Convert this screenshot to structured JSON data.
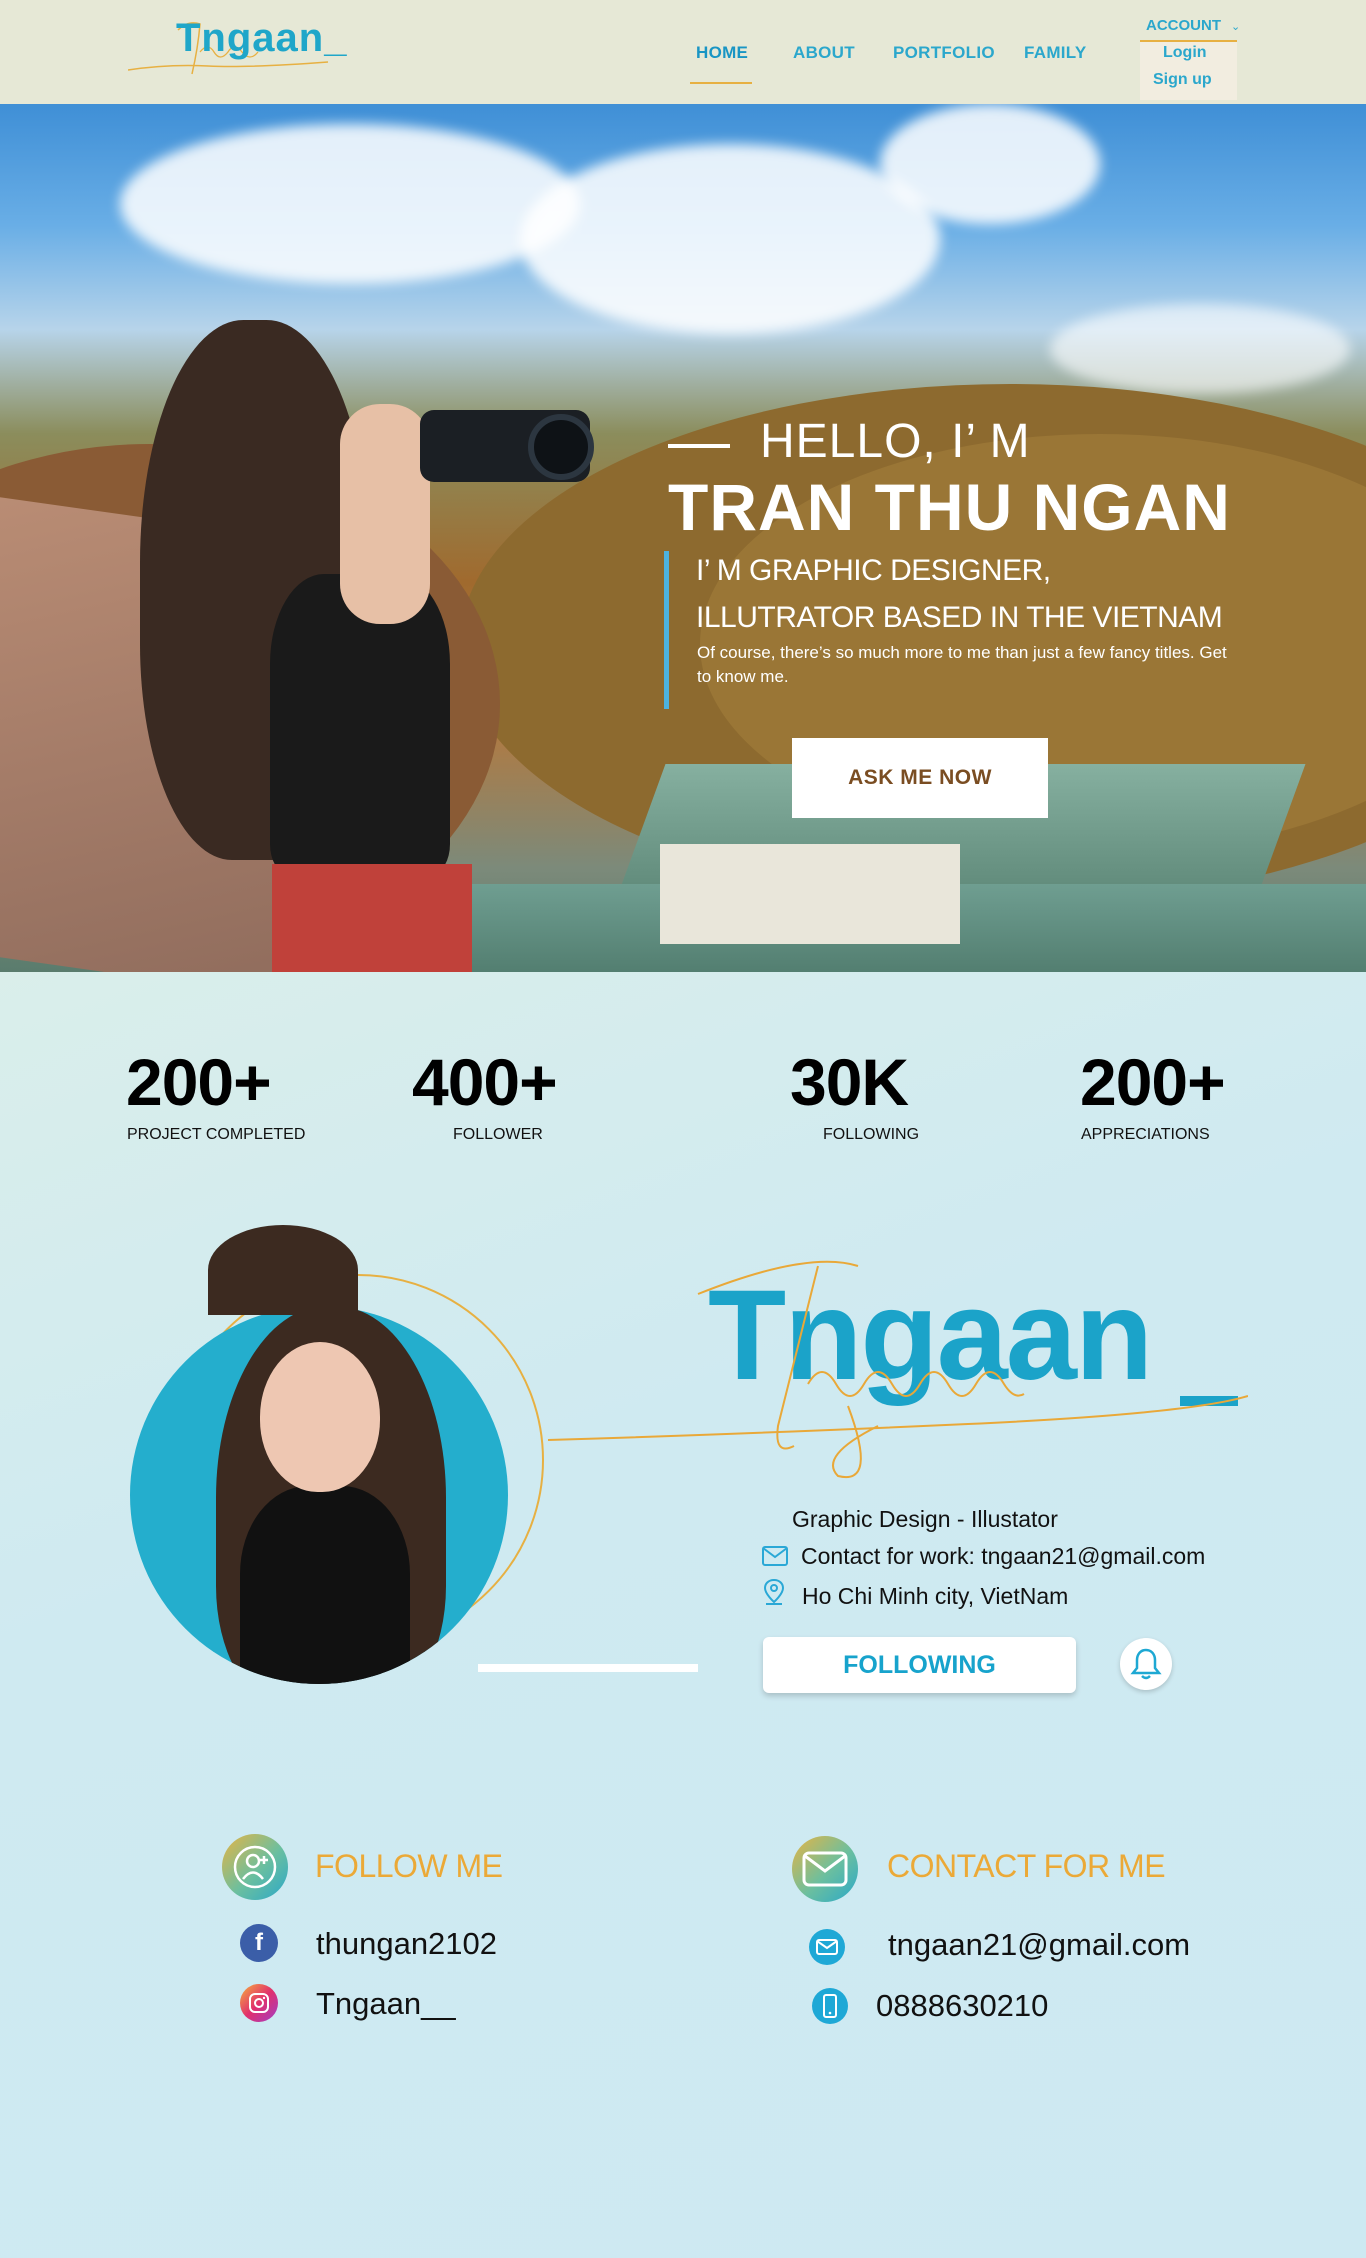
{
  "nav": {
    "logo_text": "Tngaan_",
    "items": [
      {
        "label": "HOME",
        "active": true
      },
      {
        "label": "ABOUT"
      },
      {
        "label": "PORTFOLIO"
      },
      {
        "label": "FAMILY"
      }
    ],
    "account": {
      "label": "ACCOUNT",
      "items": [
        "Login",
        "Sign up"
      ]
    }
  },
  "hero": {
    "greeting": "HELLO, I’ M",
    "name": "TRAN THU NGAN",
    "role_line1": "I’ M GRAPHIC DESIGNER,",
    "role_line2": "ILLUTRATOR BASED IN THE VIETNAM",
    "subtitle": "Of course, there’s so much more to me than just a few fancy titles. Get to know me.",
    "cta": "ASK ME NOW"
  },
  "stats": [
    {
      "value": "200+",
      "label": "PROJECT COMPLETED"
    },
    {
      "value": "400+",
      "label": "FOLLOWER"
    },
    {
      "value": "30K",
      "label": "FOLLOWING"
    },
    {
      "value": "200+",
      "label": "APPRECIATIONS"
    }
  ],
  "profile": {
    "brand": "Tngaan",
    "role": "Graphic Design - Illustator",
    "contact": "Contact for work: tngaan21@gmail.com",
    "location": "Ho Chi Minh city, VietNam",
    "follow_label": "FOLLOWING"
  },
  "follow_me": {
    "title": "FOLLOW ME",
    "facebook": "thungan2102",
    "instagram": "Tngaan__"
  },
  "contact_me": {
    "title": "CONTACT FOR ME",
    "email": "tngaan21@gmail.com",
    "phone": "0888630210"
  },
  "colors": {
    "brand_blue": "#1ba3c9",
    "accent_gold": "#e7b042",
    "nav_bg": "#e6e8d6"
  }
}
